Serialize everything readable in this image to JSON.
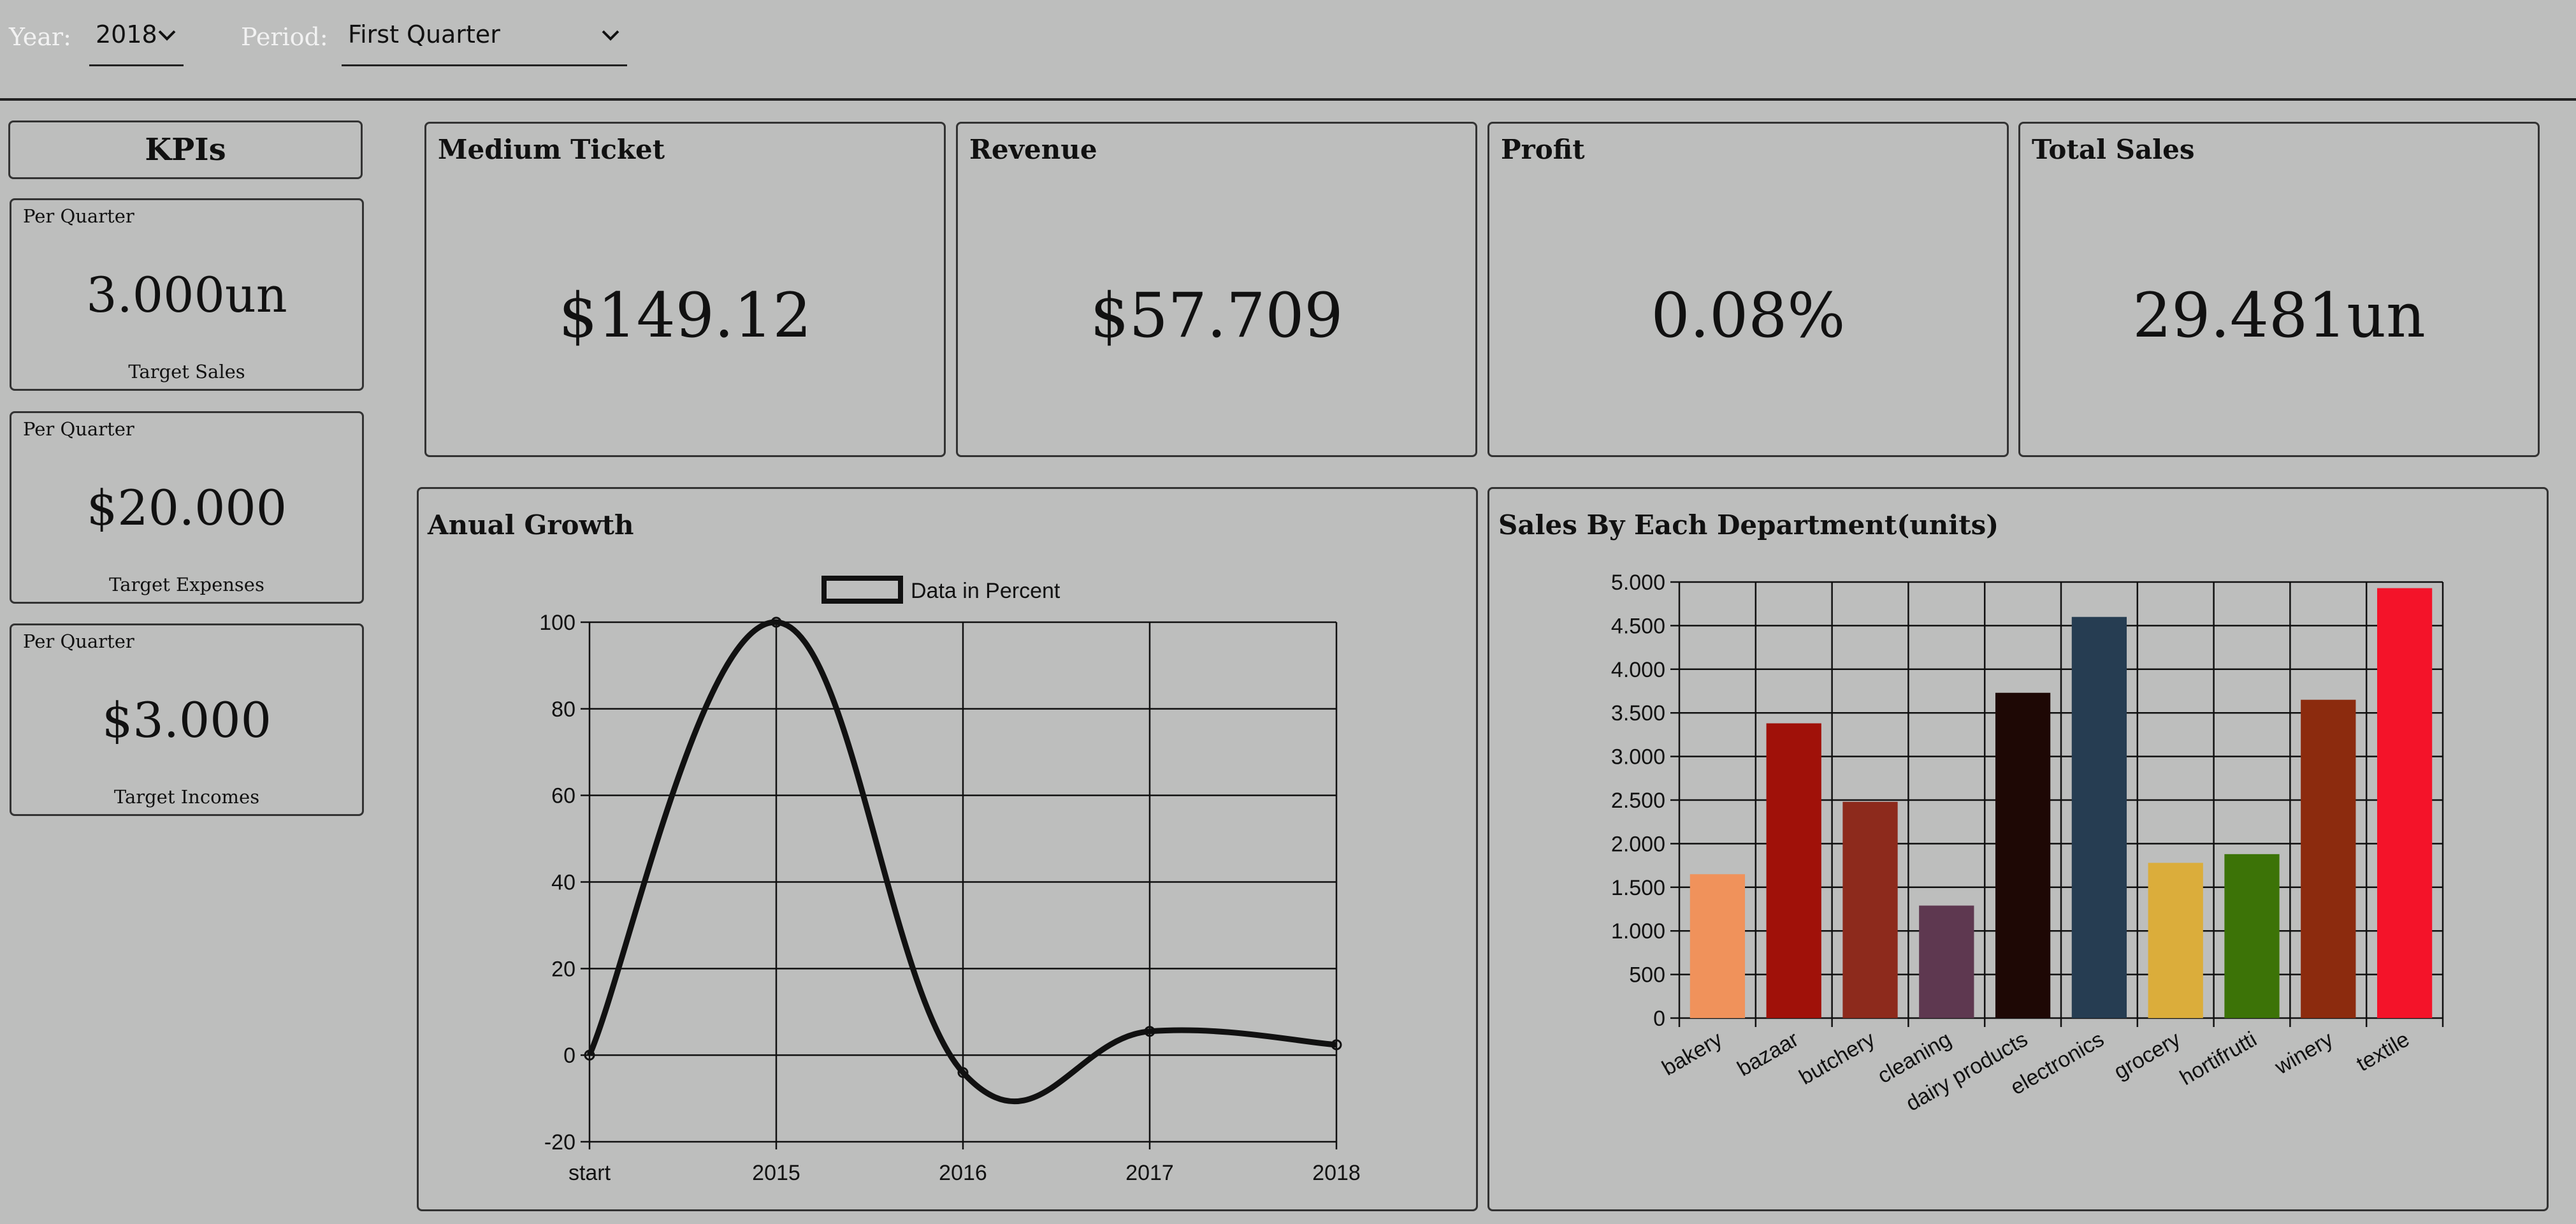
{
  "filters": {
    "year_label": "Year:",
    "year_value": "2018",
    "period_label": "Period:",
    "period_value": "First Quarter"
  },
  "kpis": {
    "header": "KPIs",
    "cards": [
      {
        "period": "Per Quarter",
        "value": "3.000un",
        "target": "Target Sales"
      },
      {
        "period": "Per Quarter",
        "value": "$20.000",
        "target": "Target Expenses"
      },
      {
        "period": "Per Quarter",
        "value": "$3.000",
        "target": "Target Incomes"
      }
    ]
  },
  "metrics": [
    {
      "title": "Medium Ticket",
      "value": "$149.12"
    },
    {
      "title": "Revenue",
      "value": "$57.709"
    },
    {
      "title": "Profit",
      "value": "0.08%"
    },
    {
      "title": "Total Sales",
      "value": "29.481un"
    }
  ],
  "icons": {
    "dropdown": "chevron-down-icon"
  },
  "colors": {
    "background": "#bdbebd",
    "filter_label": "#f2f2f2",
    "line": "#111111"
  },
  "chart_data": [
    {
      "type": "line",
      "title": "Anual Growth",
      "x": [
        "start",
        "2015",
        "2016",
        "2017",
        "2018"
      ],
      "series": [
        {
          "name": "Data in Percent",
          "values": [
            0,
            100,
            -4,
            5.5,
            2.4
          ]
        }
      ],
      "ylim": [
        -20,
        100
      ],
      "yticks": [
        -20,
        0,
        20,
        40,
        60,
        80,
        100
      ],
      "grid": true,
      "legend": "top"
    },
    {
      "type": "bar",
      "title": "Sales By Each Department(units)",
      "categories": [
        "bakery",
        "bazaar",
        "butchery",
        "cleaning",
        "dairy products",
        "electronics",
        "grocery",
        "hortifrutti",
        "winery",
        "textile"
      ],
      "values": [
        1650,
        3380,
        2480,
        1290,
        3730,
        4600,
        1780,
        1880,
        3650,
        4930
      ],
      "colors": [
        "#f0925b",
        "#a01109",
        "#8d2a1c",
        "#5e3850",
        "#1e0805",
        "#263d52",
        "#dbad3b",
        "#3c7307",
        "#8c2b0e",
        "#f41329"
      ],
      "ylim": [
        0,
        5000
      ],
      "yticks": [
        "0",
        "500",
        "1.000",
        "1.500",
        "2.000",
        "2.500",
        "3.000",
        "3.500",
        "4.000",
        "4.500",
        "5.000"
      ],
      "grid": true
    }
  ]
}
